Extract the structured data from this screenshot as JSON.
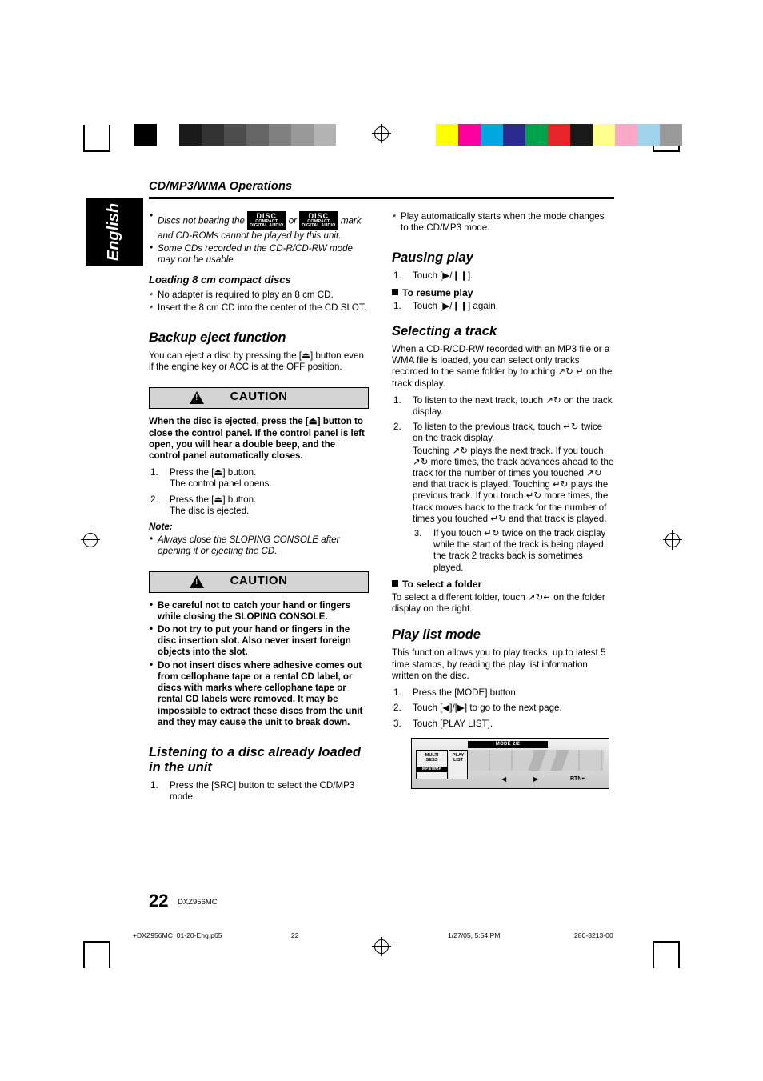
{
  "header": {
    "title": "CD/MP3/WMA Operations",
    "tab": "English"
  },
  "left": {
    "intro_bullets": [
      {
        "pre": "Discs not bearing the ",
        "logo1": "COMPACT DISC DIGITAL AUDIO",
        "mid": " or ",
        "logo2": "COMPACT DISC DIGITAL AUDIO RECORDABLE",
        "post": " mark and CD-ROMs cannot be played by this unit."
      },
      {
        "text": "Some CDs recorded in the CD-R/CD-RW mode may not be usable."
      }
    ],
    "loading_heading": "Loading 8 cm compact discs",
    "loading_items": [
      "No adapter is required to play an 8 cm CD.",
      "Insert the 8 cm CD into the center of the CD SLOT."
    ],
    "backup_heading": "Backup eject function",
    "backup_text": "You can eject a disc by pressing the [⏏] button even if the engine key or ACC is at the OFF position.",
    "caution1_label": "CAUTION",
    "caution1_body": "When the disc is ejected, press the [⏏] button to close the control panel. If the control panel is left open, you will hear a double beep, and the control panel automatically closes.",
    "caution1_steps": [
      {
        "main": "Press the [⏏] button.",
        "sub": "The control panel opens."
      },
      {
        "main": "Press the [⏏] button.",
        "sub": "The disc is ejected."
      }
    ],
    "note_label": "Note:",
    "note_text": "Always close the SLOPING CONSOLE after opening it or ejecting the CD.",
    "caution2_label": "CAUTION",
    "caution2_bullets": [
      "Be careful not to catch your hand or fingers while closing the SLOPING CONSOLE.",
      "Do not try to put your hand or fingers in the disc insertion slot. Also never insert foreign objects into the slot.",
      "Do not insert discs where adhesive comes out from cellophane tape or a rental CD label, or discs with marks where cellophane tape or rental CD labels were removed. It may be impossible to extract these discs from the unit and they may cause the unit to break down."
    ],
    "listening_heading": "Listening to a disc already loaded in the unit",
    "listening_step": "Press the [SRC] button to select the CD/MP3 mode."
  },
  "right": {
    "top_note": "Play automatically starts when the mode changes to the CD/MP3 mode.",
    "pausing_heading": "Pausing play",
    "pausing_step": "Touch [▶/❙❙].",
    "resume_heading": "To resume play",
    "resume_step": "Touch [▶/❙❙] again.",
    "selecting_heading": "Selecting a track",
    "selecting_text": "When a CD-R/CD-RW recorded with an MP3 file or a WMA file is loaded, you can select only tracks recorded to the same folder by touching ↗↻ ↵ on the track display.",
    "selecting_steps": [
      "To listen to the next track, touch ↗↻ on the track display.",
      "To listen to the previous track, touch ↵↻ twice on the track display."
    ],
    "selecting_para2": "Touching ↗↻ plays the next track. If you touch ↗↻ more times, the track advances ahead to the track for the number of times you touched ↗↻ and that track is played. Touching ↵↻ plays the previous track. If you touch ↵↻ more times, the track moves back to the track for the number of times you touched ↵↻ and that track is played.",
    "selecting_note": "If you touch ↵↻ twice on the track display while the start of the track is being played, the track 2 tracks back is sometimes played.",
    "folder_heading": "To select a folder",
    "folder_text": "To select a different folder, touch ↗↻↵ on the folder display on the right.",
    "playlist_heading": "Play list mode",
    "playlist_text": "This function allows you to play tracks, up to latest 5 time stamps, by reading the play list information written on the disc.",
    "playlist_steps": [
      "Press the [MODE] button.",
      "Touch [◀]/[▶] to go to the next page.",
      "Touch [PLAY LIST]."
    ],
    "panel": {
      "mode_label": "MODE 2/2",
      "btn1_line1": "MULTI",
      "btn1_line2": "SESS",
      "btn1_line3": "MP3/WMA",
      "btn2_line1": "PLAY",
      "btn2_line2": "LIST",
      "left_arrow": "◀",
      "right_arrow": "▶",
      "rtn_label": "RTN"
    }
  },
  "footer": {
    "page_number": "22",
    "model": "DXZ956MC",
    "file_name": "+DXZ956MC_01-20-Eng.p65",
    "page_small": "22",
    "date": "1/27/05, 5:54 PM",
    "doc_code": "280-8213-00"
  },
  "colors": {
    "caution_bg": "#d4d4d4",
    "tab_bg": "#000000"
  }
}
